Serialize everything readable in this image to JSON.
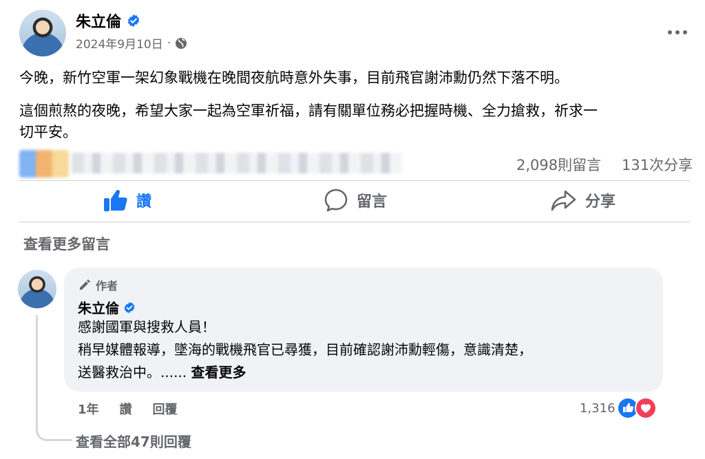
{
  "post": {
    "author": "朱立倫",
    "date": "2024年9月10日",
    "separator": "·",
    "paragraph1": "今晚，新竹空軍一架幻象戰機在晚間夜航時意外失事，目前飛官謝沛勳仍然下落不明。",
    "paragraph2_line1": "這個煎熬的夜晚，希望大家一起為空軍祈福，請有關單位務必把握時機、全力搶救，祈求一",
    "paragraph2_line2": "切平安。",
    "comments_count": "2,098則留言",
    "shares_count": "131次分享"
  },
  "actions": {
    "like": "讚",
    "comment": "留言",
    "share": "分享"
  },
  "view_more_comments": "查看更多留言",
  "comment": {
    "author_badge": "作者",
    "author": "朱立倫",
    "line1": "感謝國軍與搜救人員！",
    "line2": "稍早媒體報導，墜海的戰機飛官已尋獲，目前確認謝沛勳輕傷，意識清楚，",
    "line3": "送醫救治中。......",
    "see_more": "查看更多",
    "time": "1年",
    "like": "讚",
    "reply": "回覆",
    "reaction_count": "1,316"
  },
  "view_all_replies": "查看全部47則回覆",
  "colors": {
    "facebook_blue": "#1877f2",
    "love_red": "#f33e58",
    "bubble_bg": "#f0f2f5",
    "muted_text": "#65676b"
  },
  "icons": [
    "verified-badge-icon",
    "globe-icon",
    "more-options-icon",
    "like-icon",
    "comment-icon",
    "share-icon",
    "pencil-icon",
    "like-reaction-icon",
    "love-reaction-icon"
  ]
}
